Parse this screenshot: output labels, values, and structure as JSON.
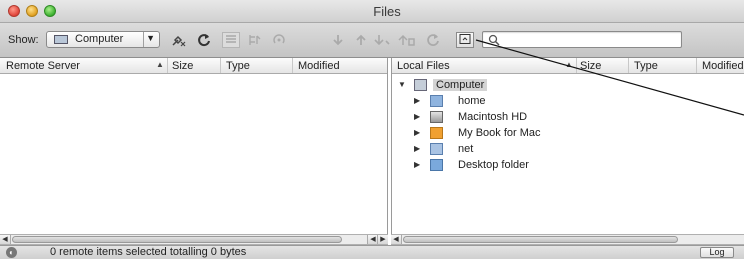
{
  "window": {
    "title": "Files"
  },
  "toolbar": {
    "show_label": "Show:",
    "location": {
      "selected": "Computer",
      "icon": "computer-icon"
    },
    "icons": [
      "disconnect-icon",
      "refresh-icon",
      "list-view-icon",
      "info-icon",
      "folder-sync-icon",
      "download-icon",
      "upload-icon",
      "download-to-icon",
      "upload-from-icon",
      "sync-icon",
      "sidebar-toggle-icon"
    ],
    "search": {
      "value": "",
      "placeholder": ""
    }
  },
  "remote_pane": {
    "columns": [
      "Remote Server",
      "Size",
      "Type",
      "Modified"
    ],
    "rows": []
  },
  "local_pane": {
    "columns": [
      "Local Files",
      "Size",
      "Type",
      "Modified"
    ],
    "root": {
      "label": "Computer",
      "icon": "computer-icon",
      "expanded": true
    },
    "items": [
      {
        "label": "home",
        "icon": "home-folder-icon"
      },
      {
        "label": "Macintosh HD",
        "icon": "hard-drive-icon"
      },
      {
        "label": "My Book for Mac",
        "icon": "external-drive-icon"
      },
      {
        "label": "net",
        "icon": "network-drive-icon"
      },
      {
        "label": "Desktop folder",
        "icon": "folder-icon"
      }
    ]
  },
  "status": {
    "text": "0 remote items selected totalling 0 bytes",
    "log_button": "Log"
  },
  "colors": {
    "toolbar_top": "#dcdcdc",
    "toolbar_bottom": "#c4c4c4",
    "selection": "#d4d4d4",
    "folder_blue": "#8fb4df",
    "drive_orange": "#f0a030"
  }
}
